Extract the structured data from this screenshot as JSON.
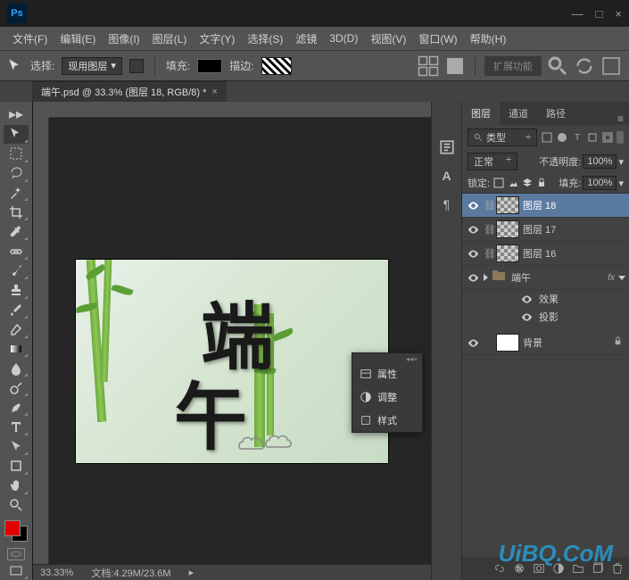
{
  "menubar": [
    "文件(F)",
    "编辑(E)",
    "图像(I)",
    "图层(L)",
    "文字(Y)",
    "选择(S)",
    "滤镜",
    "3D(D)",
    "视图(V)",
    "窗口(W)",
    "帮助(H)"
  ],
  "optionsbar": {
    "select_label": "选择:",
    "select_value": "现用图层",
    "fill_label": "填充:",
    "stroke_label": "描边:",
    "workspace": "扩展功能"
  },
  "doctab": {
    "label": "端午.psd @ 33.3% (图层 18, RGB/8) *"
  },
  "status": {
    "zoom": "33.33%",
    "docinfo": "文档:4.29M/23.6M"
  },
  "panels": {
    "tabs": [
      "图层",
      "通道",
      "路径"
    ],
    "filter_label": "类型",
    "blend_mode": "正常",
    "opacity_label": "不透明度:",
    "opacity_value": "100%",
    "lock_label": "锁定:",
    "fill_label": "填充:",
    "fill_value": "100%"
  },
  "layers": [
    {
      "name": "图层 18",
      "thumb": "checker",
      "selected": true
    },
    {
      "name": "图层 17",
      "thumb": "checker"
    },
    {
      "name": "图层 16",
      "thumb": "checker"
    },
    {
      "name": "端午",
      "thumb": "folder",
      "fx": true
    },
    {
      "name": "背景",
      "thumb": "white",
      "locked": true
    }
  ],
  "fx_rows": [
    "效果",
    "投影"
  ],
  "popup": {
    "rows": [
      "属性",
      "调整",
      "样式"
    ]
  },
  "watermark": "UiBQ.CoM"
}
